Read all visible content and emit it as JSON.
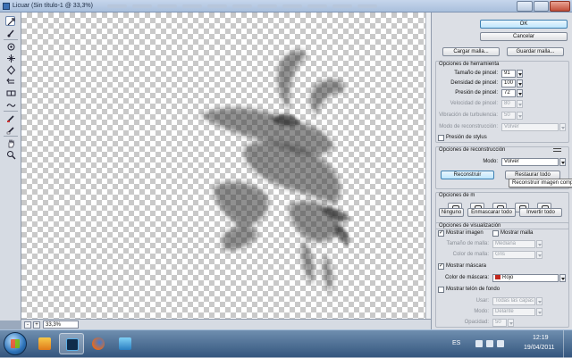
{
  "window": {
    "title": "Licuar (Sin título-1 @ 33,3%)"
  },
  "status": {
    "zoom": "33,3%"
  },
  "buttons": {
    "ok": "OK",
    "cancel": "Cancelar",
    "load_mesh": "Cargar malla...",
    "save_mesh": "Guardar malla..."
  },
  "tool_options": {
    "title": "Opciones de herramienta",
    "brush_size": {
      "label": "Tamaño de pincel:",
      "value": "91"
    },
    "brush_density": {
      "label": "Densidad de pincel:",
      "value": "100"
    },
    "brush_pressure": {
      "label": "Presión de pincel:",
      "value": "72"
    },
    "brush_rate": {
      "label": "Velocidad de pincel:",
      "value": "80"
    },
    "turbulent_jitter": {
      "label": "Vibración de turbulencia:",
      "value": "50"
    },
    "reconstruct_mode": {
      "label": "Modo de reconstrucción:",
      "value": "Volver"
    },
    "stylus_pressure": {
      "label": "Presión de stylus",
      "checked": false
    }
  },
  "reconstruct_options": {
    "title": "Opciones de reconstrucción",
    "mode_label": "Modo:",
    "mode_value": "Volver",
    "reconstruct_label": "Reconstruir",
    "restore_all_label": "Restaurar todo",
    "tooltip": "Reconstruir imagen completa"
  },
  "mask_options": {
    "title": "Opciones de m",
    "none": "Ninguno",
    "mask_all": "Enmascarar todo",
    "invert_all": "Invertir todo"
  },
  "view_options": {
    "title": "Opciones de visualización",
    "show_image": {
      "label": "Mostrar imagen",
      "checked": true
    },
    "show_mesh": {
      "label": "Mostrar malla",
      "checked": false
    },
    "mesh_size": {
      "label": "Tamaño de malla:",
      "value": "Mediana"
    },
    "mesh_color": {
      "label": "Color de malla:",
      "value": "Gris"
    },
    "show_mask": {
      "label": "Mostrar máscara",
      "checked": true
    },
    "mask_color": {
      "label": "Color de máscara:",
      "value": "Rojo"
    },
    "show_backdrop": {
      "label": "Mostrar telón de fondo",
      "checked": false
    },
    "use": {
      "label": "Usar:",
      "value": "Todas las capas"
    },
    "mode": {
      "label": "Modo:",
      "value": "Delante"
    },
    "opacity": {
      "label": "Opacidad:",
      "value": "50"
    }
  },
  "taskbar": {
    "lang": "ES",
    "time": "12:19",
    "date": "19/04/2011"
  },
  "colors": {
    "mask_swatch": "#c0281e",
    "accent": "#3c7fb1"
  }
}
